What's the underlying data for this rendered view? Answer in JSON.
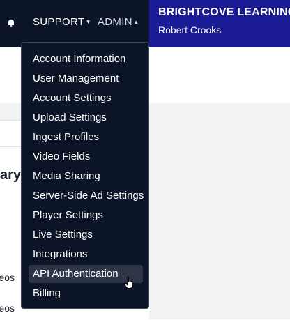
{
  "topbar": {
    "bell_icon": "bell-icon",
    "support_label": "SUPPORT",
    "support_caret": "▾",
    "admin_label": "ADMIN",
    "admin_caret": "▴"
  },
  "account": {
    "name": "BRIGHTCOVE LEARNING",
    "user": "Robert Crooks"
  },
  "background": {
    "heading_fragment": "ary",
    "text_fragment_1": "eos",
    "text_fragment_2": "eos"
  },
  "admin_menu": {
    "items": [
      "Account Information",
      "User Management",
      "Account Settings",
      "Upload Settings",
      "Ingest Profiles",
      "Video Fields",
      "Media Sharing",
      "Server-Side Ad Settings",
      "Player Settings",
      "Live Settings",
      "Integrations",
      "API Authentication",
      "Billing"
    ],
    "hovered_item": "API Authentication"
  },
  "colors": {
    "topbar": "#0c1527",
    "account_panel": "#1a1b94",
    "menu_hover": "#2e3546"
  }
}
